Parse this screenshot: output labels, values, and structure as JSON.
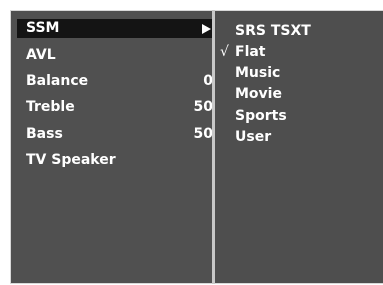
{
  "main_menu": {
    "items": [
      {
        "label": "SSM",
        "value": "",
        "submenu": true,
        "selected": true
      },
      {
        "label": "AVL",
        "value": ""
      },
      {
        "label": "Balance",
        "value": "0"
      },
      {
        "label": "Treble",
        "value": "50"
      },
      {
        "label": "Bass",
        "value": "50"
      },
      {
        "label": "TV Speaker",
        "value": ""
      }
    ]
  },
  "ssm_submenu": {
    "check_mark": "√",
    "options": [
      {
        "label": "SRS TSXT",
        "checked": false
      },
      {
        "label": "Flat",
        "checked": true
      },
      {
        "label": "Music",
        "checked": false
      },
      {
        "label": "Movie",
        "checked": false
      },
      {
        "label": "Sports",
        "checked": false
      },
      {
        "label": "User",
        "checked": false
      }
    ]
  },
  "icons": {
    "submenu_arrow": "right-triangle-icon"
  }
}
